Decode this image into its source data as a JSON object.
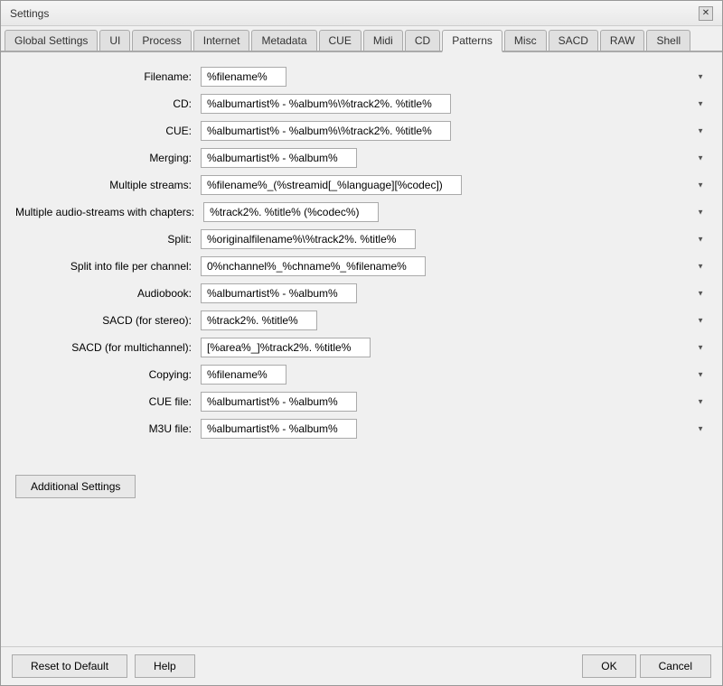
{
  "window": {
    "title": "Settings",
    "close_label": "✕"
  },
  "tabs": [
    {
      "id": "global-settings",
      "label": "Global Settings",
      "active": false
    },
    {
      "id": "ui",
      "label": "UI",
      "active": false
    },
    {
      "id": "process",
      "label": "Process",
      "active": false
    },
    {
      "id": "internet",
      "label": "Internet",
      "active": false
    },
    {
      "id": "metadata",
      "label": "Metadata",
      "active": false
    },
    {
      "id": "cue",
      "label": "CUE",
      "active": false
    },
    {
      "id": "midi",
      "label": "Midi",
      "active": false
    },
    {
      "id": "cd",
      "label": "CD",
      "active": false
    },
    {
      "id": "patterns",
      "label": "Patterns",
      "active": true
    },
    {
      "id": "misc",
      "label": "Misc",
      "active": false
    },
    {
      "id": "sacd",
      "label": "SACD",
      "active": false
    },
    {
      "id": "raw",
      "label": "RAW",
      "active": false
    },
    {
      "id": "shell",
      "label": "Shell",
      "active": false
    }
  ],
  "rows": [
    {
      "label": "Filename:",
      "value": "%filename%"
    },
    {
      "label": "CD:",
      "value": "%albumartist% - %album%\\%track2%. %title%"
    },
    {
      "label": "CUE:",
      "value": "%albumartist% - %album%\\%track2%. %title%"
    },
    {
      "label": "Merging:",
      "value": "%albumartist% - %album%"
    },
    {
      "label": "Multiple streams:",
      "value": "%filename%_(%streamid[_%language][%codec])"
    },
    {
      "label": "Multiple audio-streams with chapters:",
      "value": "%track2%. %title% (%codec%)"
    },
    {
      "label": "Split:",
      "value": "%originalfilename%\\%track2%. %title%"
    },
    {
      "label": "Split into file per channel:",
      "value": "0%nchannel%_%chname%_%filename%"
    },
    {
      "label": "Audiobook:",
      "value": "%albumartist% - %album%"
    },
    {
      "label": "SACD (for stereo):",
      "value": "%track2%. %title%"
    },
    {
      "label": "SACD (for multichannel):",
      "value": "[%area%_]%track2%. %title%"
    },
    {
      "label": "Copying:",
      "value": "%filename%"
    },
    {
      "label": "CUE file:",
      "value": "%albumartist% - %album%"
    },
    {
      "label": "M3U file:",
      "value": "%albumartist% - %album%"
    }
  ],
  "additional_settings_label": "Additional Settings",
  "footer": {
    "reset_label": "Reset to Default",
    "help_label": "Help",
    "ok_label": "OK",
    "cancel_label": "Cancel"
  }
}
